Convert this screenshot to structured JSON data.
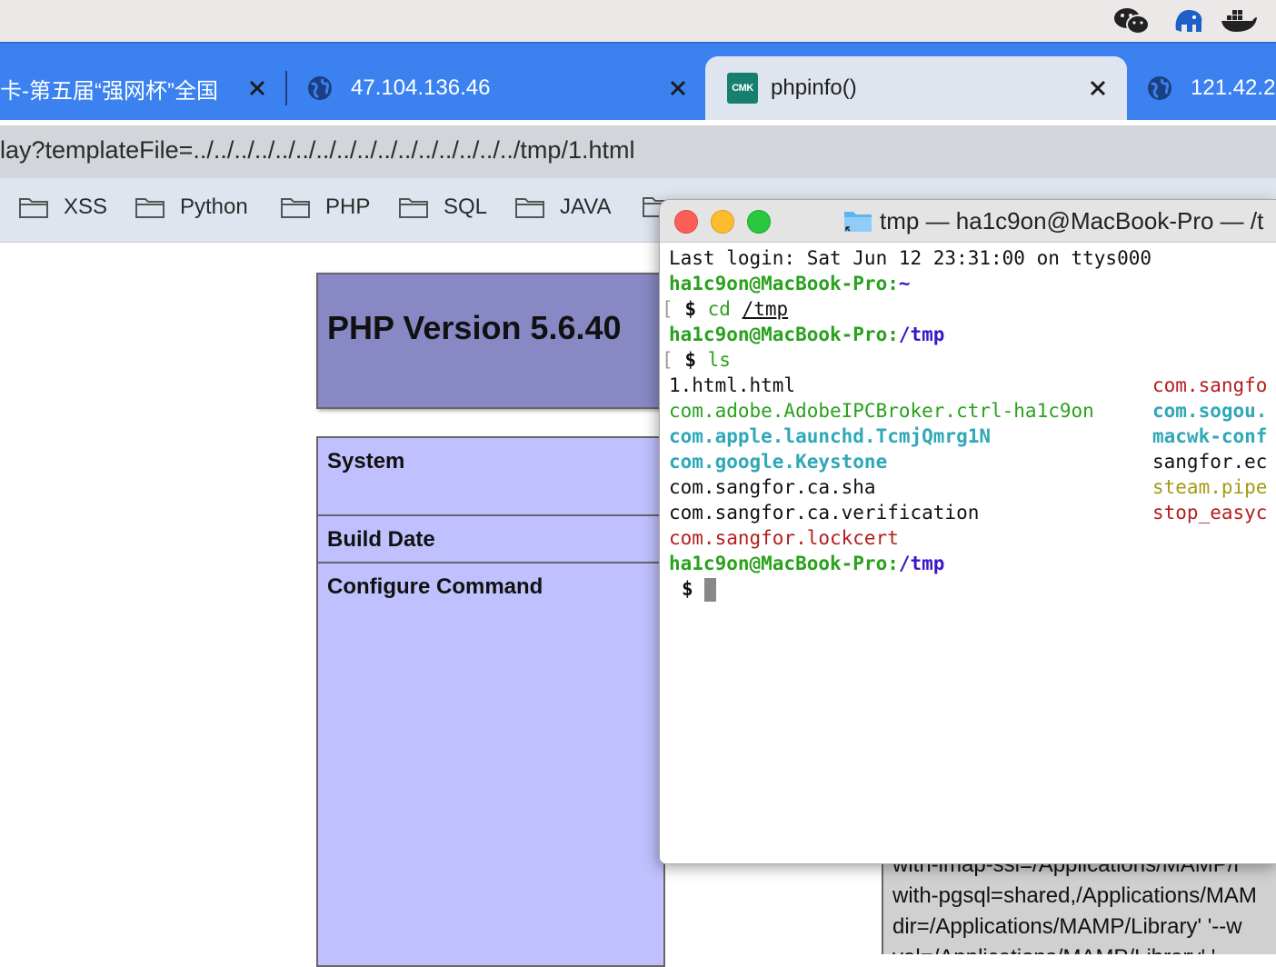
{
  "browser": {
    "tabs": [
      {
        "title": "卡-第五届“强网杯”全国",
        "active": false,
        "icon": "favicon"
      },
      {
        "title": "47.104.136.46",
        "active": false,
        "icon": "globe-icon"
      },
      {
        "title": "phpinfo()",
        "active": true,
        "icon": "cmk-icon",
        "icon_text": "CMK"
      },
      {
        "title": "121.42.2",
        "active": false,
        "icon": "globe-icon"
      }
    ],
    "address": "lay?templateFile=../../../../../../../../../../../../../../../../tmp/1.html",
    "bookmarks": [
      "XSS",
      "Python",
      "PHP",
      "SQL",
      "JAVA"
    ]
  },
  "phpinfo": {
    "title": "PHP Version 5.6.40",
    "rows": [
      "System",
      "Build Date",
      "Configure Command"
    ],
    "configure_lines": [
      "with-imap-ssl=/Applications/MAMP/l",
      "with-pgsql=shared,/Applications/MAM",
      "dir=/Applications/MAMP/Library' '--w",
      "val=/Applications/MAMP/Library' '--"
    ]
  },
  "terminal": {
    "title": "tmp — ha1c9on@MacBook-Pro — /t",
    "last_login": "Last login: Sat Jun 12 23:31:00 on ttys000",
    "user_host": "ha1c9on@MacBook-Pro",
    "sep": ":",
    "home_path": "~",
    "tmp_path": "/tmp",
    "bracket": "[",
    "dollar": "$",
    "cmd1_name": "cd",
    "cmd1_arg": "/tmp",
    "cmd2": "ls",
    "ls_left": [
      {
        "name": "1.html.html",
        "style": "black"
      },
      {
        "name": "com.adobe.AdobeIPCBroker.ctrl-ha1c9on",
        "style": "green"
      },
      {
        "name": "com.apple.launchd.TcmjQmrg1N",
        "style": "cyan"
      },
      {
        "name": "com.google.Keystone",
        "style": "cyan"
      },
      {
        "name": "com.sangfor.ca.sha",
        "style": "black"
      },
      {
        "name": "com.sangfor.ca.verification",
        "style": "black"
      },
      {
        "name": "com.sangfor.lockcert",
        "style": "red"
      }
    ],
    "ls_right": [
      {
        "name": "com.sangfo",
        "style": "red"
      },
      {
        "name": "com.sogou.",
        "style": "cyan"
      },
      {
        "name": "macwk-conf",
        "style": "cyan"
      },
      {
        "name": "sangfor.ec",
        "style": "black"
      },
      {
        "name": "steam.pipe",
        "style": "olive"
      },
      {
        "name": "stop_easyc",
        "style": "red"
      }
    ]
  },
  "menubar": {
    "icons": [
      "wechat-icon",
      "sequel-pro-icon",
      "docker-icon"
    ]
  }
}
